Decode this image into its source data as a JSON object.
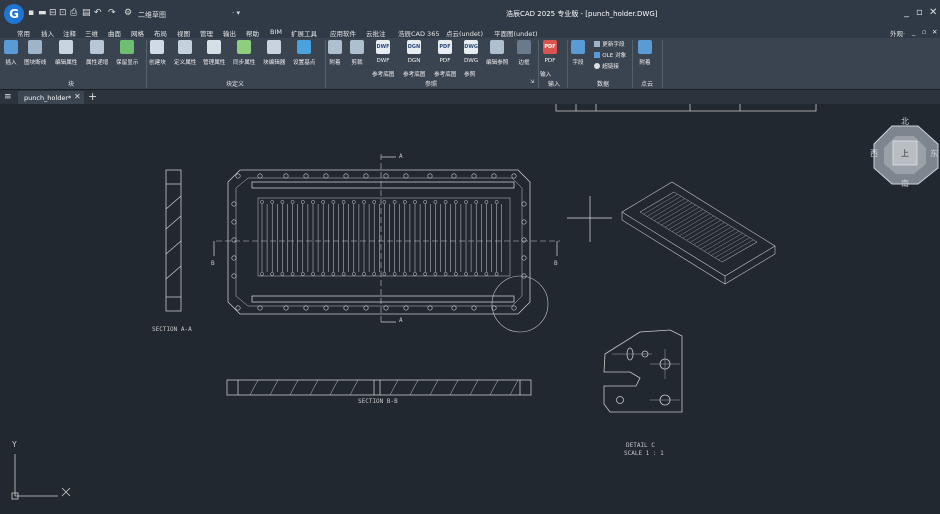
{
  "app": {
    "title": "浩辰CAD 2025 专业版 - [punch_holder.DWG]",
    "workspace": "二维草图",
    "logo_letter": "G",
    "appearance_label": "外观·"
  },
  "menu": [
    "常用",
    "插入",
    "注释",
    "三维",
    "曲面",
    "网格",
    "布局",
    "视图",
    "管理",
    "输出",
    "帮助",
    "BIM",
    "扩展工具",
    "应用软件",
    "云批注",
    "浩辰CAD 365",
    "点云(undet)",
    "平面图(undet)"
  ],
  "ribbon": {
    "block_group": {
      "label": "块",
      "buttons": [
        {
          "label": "插入",
          "icon": "insert-block-icon"
        },
        {
          "label": "图块断线",
          "icon": "block-break-icon"
        },
        {
          "label": "编辑属性",
          "icon": "edit-attribute-icon"
        },
        {
          "label": "属性递增",
          "icon": "attribute-increment-icon"
        },
        {
          "label": "保留显示",
          "icon": "keep-display-icon"
        }
      ]
    },
    "block_def_group": {
      "label": "块定义",
      "buttons": [
        {
          "label": "创建块",
          "icon": "create-block-icon"
        },
        {
          "label": "定义属性",
          "icon": "define-attribute-icon"
        },
        {
          "label": "管理属性",
          "icon": "manage-attribute-icon"
        },
        {
          "label": "同步属性",
          "icon": "sync-attribute-icon"
        },
        {
          "label": "块编辑器",
          "icon": "block-editor-icon"
        },
        {
          "label": "设置基点",
          "icon": "set-basepoint-icon"
        }
      ]
    },
    "reference_group": {
      "label": "参照",
      "buttons": [
        {
          "label": "附着",
          "icon": "attach-icon"
        },
        {
          "label": "剪裁",
          "icon": "clip-icon"
        },
        {
          "label": "DWF",
          "icon": "dwf-icon",
          "icon_text": "DWF"
        },
        {
          "label": "DGN",
          "icon": "dgn-icon",
          "icon_text": "DGN"
        },
        {
          "label": "PDF",
          "icon": "pdf-icon",
          "icon_text": "PDF"
        },
        {
          "label": "DWG",
          "icon": "dwg-icon",
          "icon_text": "DWG"
        },
        {
          "label": "编辑参照",
          "icon": "edit-reference-icon"
        },
        {
          "label": "边框",
          "icon": "frame-icon"
        }
      ],
      "sub_labels": [
        "参考底图",
        "参考底图",
        "参考底图",
        "参照"
      ]
    },
    "import_group": {
      "label": "输入",
      "buttons": [
        {
          "label": "PDF",
          "icon": "pdf-import-icon",
          "icon_text": "PDF"
        }
      ],
      "sub_label": "输入"
    },
    "data_group": {
      "label": "数据",
      "buttons": [
        {
          "label": "字段",
          "icon": "field-icon"
        }
      ],
      "small": [
        {
          "label": "更新字段",
          "icon": "update-field-icon"
        },
        {
          "label": "OLE 对象",
          "icon": "ole-object-icon"
        },
        {
          "label": "超链接",
          "icon": "hyperlink-icon"
        }
      ]
    },
    "pointcloud_group": {
      "label": "点云",
      "buttons": [
        {
          "label": "附着",
          "icon": "pointcloud-attach-icon"
        }
      ]
    }
  },
  "tabs": [
    {
      "label": "punch_holder*"
    }
  ],
  "viewcube": {
    "north": "北",
    "south": "南",
    "west": "西",
    "east": "东",
    "top": "上"
  },
  "drawing": {
    "section_aa": "SECTION A-A",
    "section_bb": "SECTION B-B",
    "detail_c": "DETAIL C",
    "detail_scale": "SCALE 1 : 1",
    "cut_a": "A",
    "cut_b": "B",
    "ucs_y": "Y"
  },
  "colors": {
    "canvas": "#212830",
    "ribbon": "#3a4350",
    "titlebar": "#2f3a46",
    "accent": "#1f76d2",
    "line": "#c8c8c8"
  }
}
